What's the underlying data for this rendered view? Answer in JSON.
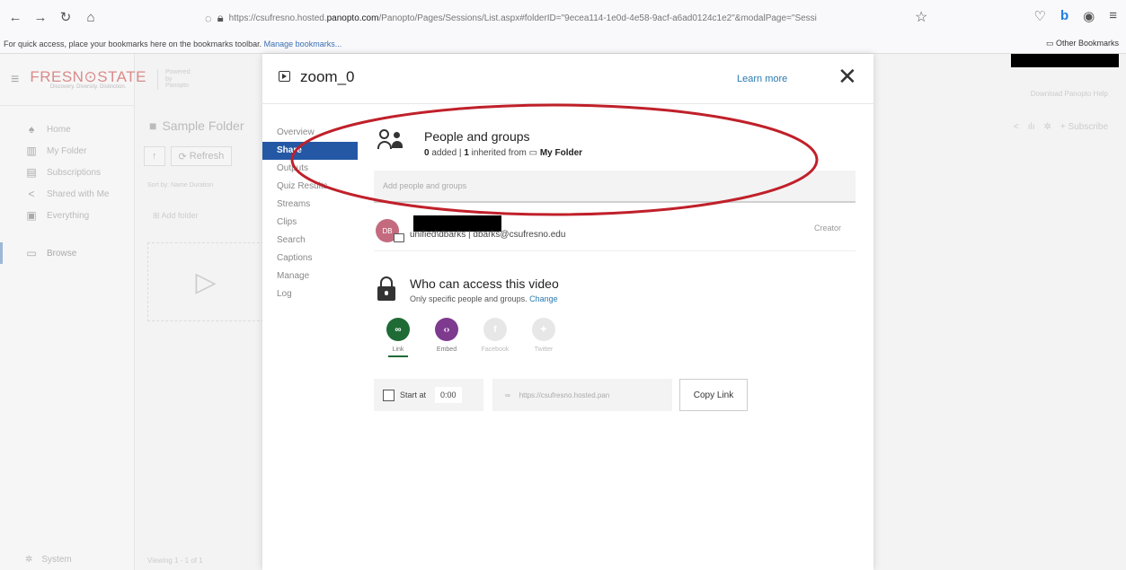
{
  "browser": {
    "url_prefix": "https://csufresno.hosted.",
    "url_domain": "panopto.com",
    "url_rest": "/Panopto/Pages/Sessions/List.aspx#folderID=\"9ecea114-1e0d-4e58-9acf-a6ad0124c1e2\"&modalPage=\"Sessi",
    "bookmarks_text": "For quick access, place your bookmarks here on the bookmarks toolbar.",
    "manage_bookmarks": "Manage bookmarks...",
    "other_bookmarks": "Other Bookmarks"
  },
  "app": {
    "logo": "FRESN⊙STATE",
    "logo_sub": "Discovery. Diversity. Distinction.",
    "powered_by": "Powered by Panopto",
    "sidebar": [
      {
        "label": "Home",
        "icon": "home-icon"
      },
      {
        "label": "My Folder",
        "icon": "folder-icon"
      },
      {
        "label": "Subscriptions",
        "icon": "subscriptions-icon"
      },
      {
        "label": "Shared with Me",
        "icon": "share-icon"
      },
      {
        "label": "Everything",
        "icon": "everything-icon"
      }
    ],
    "browse": "Browse",
    "system": "System",
    "folder_title": "Sample Folder",
    "refresh": "Refresh",
    "sort_line": "Sort by: Name  Duration",
    "add_folder": "Add folder",
    "viewing": "Viewing 1 - 1 of 1",
    "download": "Download Panopto  Help",
    "subscribe": "Subscribe"
  },
  "modal": {
    "title": "zoom_0",
    "learn_more": "Learn more",
    "menu": [
      "Overview",
      "Share",
      "Outputs",
      "Quiz Results",
      "Streams",
      "Clips",
      "Search",
      "Captions",
      "Manage",
      "Log"
    ],
    "active_menu": "Share",
    "people_title": "People and groups",
    "added_count": "0",
    "added_label": "added",
    "inherited_count": "1",
    "inherited_label": "inherited from",
    "inherited_folder": "My Folder",
    "add_placeholder": "Add people and groups",
    "owner_initials": "DB",
    "owner_email": "unified\\dbarks | dbarks@csufresno.edu",
    "owner_role": "Creator",
    "access_title": "Who can access this video",
    "access_sub": "Only specific people and groups.",
    "access_change": "Change",
    "share_options": [
      {
        "label": "Link",
        "color": "#1e6b35"
      },
      {
        "label": "Embed",
        "color": "#7e3a8e"
      },
      {
        "label": "Facebook",
        "color": "#e7e7e7"
      },
      {
        "label": "Twitter",
        "color": "#e7e7e7"
      }
    ],
    "start_at_label": "Start at",
    "start_at_value": "0:00",
    "link_value": "https://csufresno.hosted.pan",
    "copy_link": "Copy Link"
  },
  "colors": {
    "annotation_ellipse": "#c0202a",
    "accent": "#2458a4"
  }
}
